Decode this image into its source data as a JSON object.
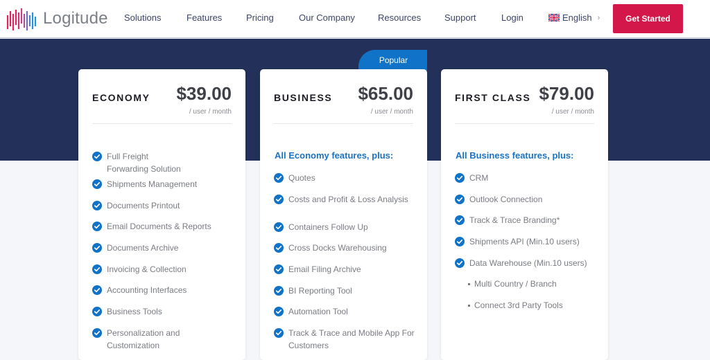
{
  "header": {
    "brand": "Logitude",
    "nav": [
      "Solutions",
      "Features",
      "Pricing",
      "Our Company",
      "Resources",
      "Support",
      "Login"
    ],
    "language": "English",
    "cta": "Get Started"
  },
  "colors": {
    "accent_blue": "#1173c7",
    "cta_red": "#d3174a",
    "band_navy": "#233059"
  },
  "plans": [
    {
      "name": "ECONOMY",
      "price": "$39.00",
      "per": "/ user / month",
      "subhead": "",
      "features": [
        {
          "text": "Full Freight Forwarding Solution",
          "type": "check"
        },
        {
          "text": "Shipments Management",
          "type": "check"
        },
        {
          "text": "Documents Printout",
          "type": "check"
        },
        {
          "text": "Email Documents & Reports",
          "type": "check"
        },
        {
          "text": "Documents Archive",
          "type": "check"
        },
        {
          "text": "Invoicing & Collection",
          "type": "check"
        },
        {
          "text": "Accounting Interfaces",
          "type": "check"
        },
        {
          "text": "Business Tools",
          "type": "check"
        },
        {
          "text": "Personalization and Customization",
          "type": "check"
        }
      ]
    },
    {
      "name": "BUSINESS",
      "badge": "Popular",
      "price": "$65.00",
      "per": "/ user / month",
      "subhead": "All Economy features, plus:",
      "features": [
        {
          "text": "Quotes",
          "type": "check"
        },
        {
          "text": "Costs and Profit & Loss Analysis",
          "type": "check"
        },
        {
          "text": "Containers Follow Up",
          "type": "check"
        },
        {
          "text": "Cross Docks Warehousing",
          "type": "check"
        },
        {
          "text": "Email Filing Archive",
          "type": "check"
        },
        {
          "text": "BI Reporting Tool",
          "type": "check"
        },
        {
          "text": "Automation Tool",
          "type": "check"
        },
        {
          "text": "Track & Trace and Mobile App For Customers",
          "type": "check"
        }
      ]
    },
    {
      "name": "FIRST CLASS",
      "price": "$79.00",
      "per": "/ user / month",
      "subhead": "All Business features, plus:",
      "features": [
        {
          "text": "CRM",
          "type": "check"
        },
        {
          "text": "Outlook Connection",
          "type": "check"
        },
        {
          "text": "Track & Trace Branding*",
          "type": "check"
        },
        {
          "text": "Shipments API (Min.10 users)",
          "type": "check"
        },
        {
          "text": "Data Warehouse (Min.10 users)",
          "type": "check"
        },
        {
          "text": "Multi Country / Branch",
          "type": "bullet"
        },
        {
          "text": "Connect 3rd Party Tools",
          "type": "bullet"
        }
      ]
    }
  ]
}
